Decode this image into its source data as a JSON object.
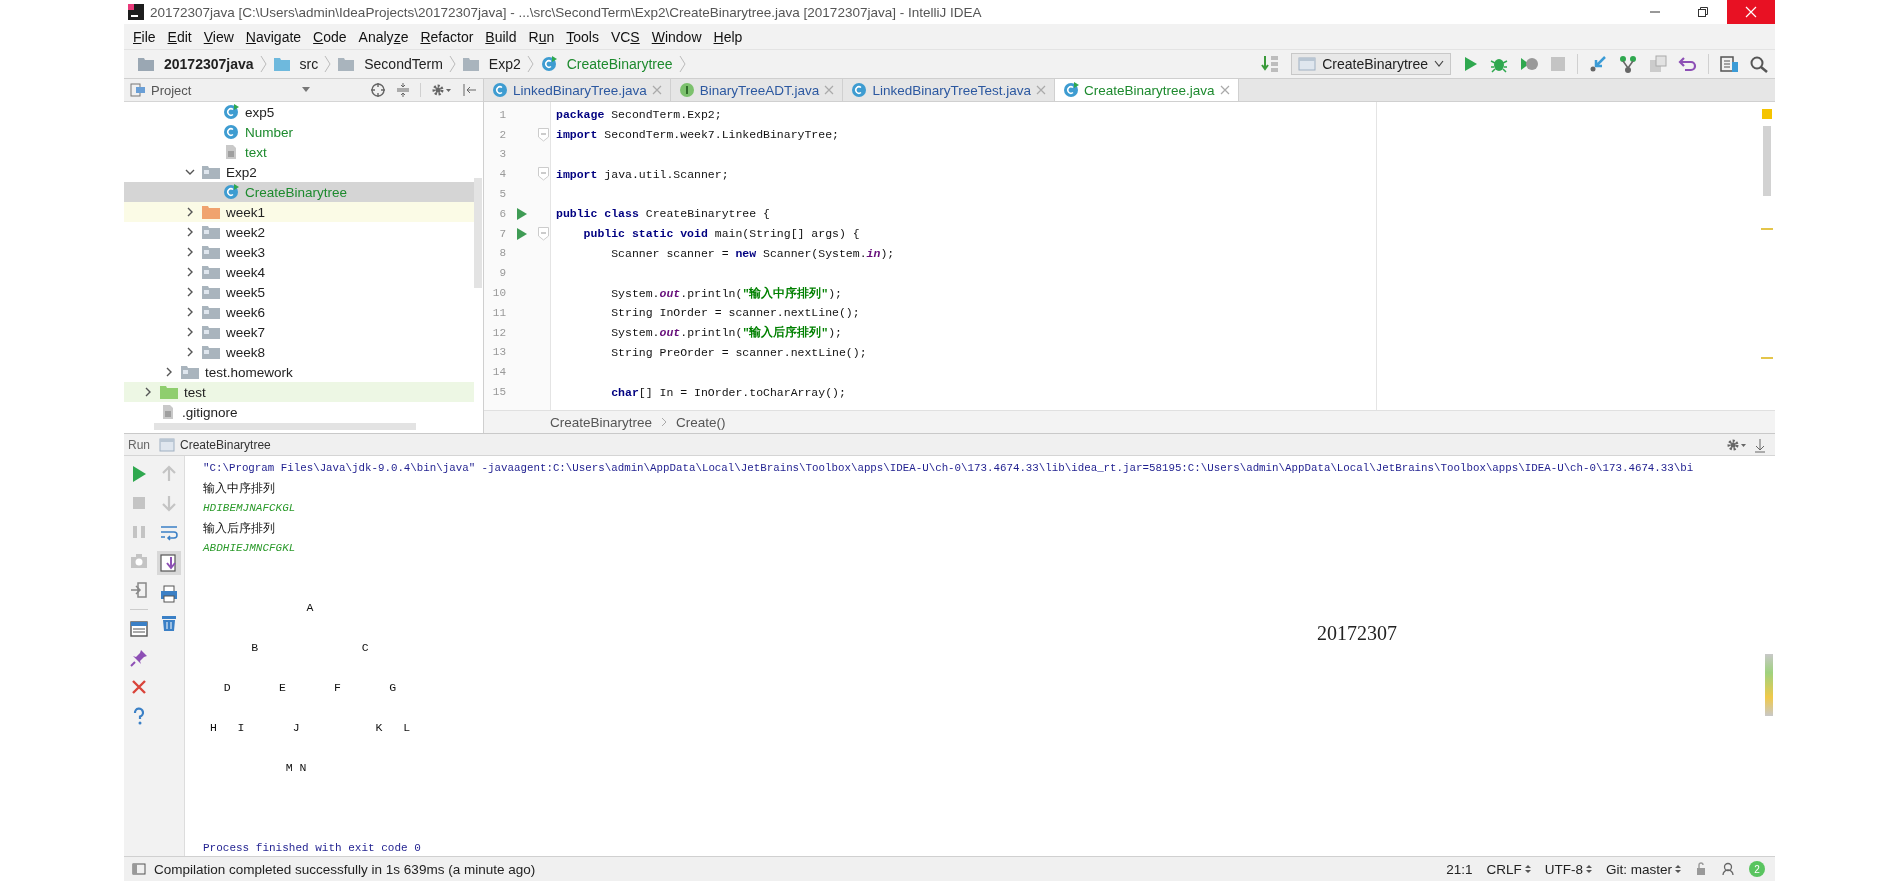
{
  "window": {
    "title": "20172307java [C:\\Users\\admin\\IdeaProjects\\20172307java] - ...\\src\\SecondTerm\\Exp2\\CreateBinarytree.java [20172307java] - IntelliJ IDEA"
  },
  "menu": [
    {
      "key": "F",
      "post": "ile"
    },
    {
      "key": "E",
      "post": "dit"
    },
    {
      "key": "V",
      "post": "iew"
    },
    {
      "key": "N",
      "post": "avigate"
    },
    {
      "key": "C",
      "post": "ode"
    },
    {
      "pre": "Analy",
      "key": "z",
      "post": "e"
    },
    {
      "key": "R",
      "post": "efactor"
    },
    {
      "key": "B",
      "post": "uild"
    },
    {
      "pre": "R",
      "key": "u",
      "post": "n"
    },
    {
      "key": "T",
      "post": "ools"
    },
    {
      "pre": "VC",
      "key": "S"
    },
    {
      "key": "W",
      "post": "indow"
    },
    {
      "key": "H",
      "post": "elp"
    }
  ],
  "breadcrumbs": [
    {
      "label": "20172307java",
      "kind": "project"
    },
    {
      "label": "src",
      "kind": "source_folder"
    },
    {
      "label": "SecondTerm",
      "kind": "folder"
    },
    {
      "label": "Exp2",
      "kind": "folder"
    },
    {
      "label": "CreateBinarytree",
      "kind": "main_class"
    }
  ],
  "run_configuration": "CreateBinarytree",
  "project": {
    "title": "Project",
    "tree": [
      {
        "children": [
          {
            "children": [
              {
                "children": [
                  {
                    "name": "exp5",
                    "kind": "main_class",
                    "vcs_added": false,
                    "selected": false
                  },
                  {
                    "name": "Number",
                    "kind": "class",
                    "vcs_added": true,
                    "selected": false
                  },
                  {
                    "name": "text",
                    "kind": "file",
                    "vcs_added": true,
                    "selected": false
                  }
                ]
              },
              {
                "name": "Exp2",
                "kind": "folder",
                "vcs_added": false,
                "expanded": true,
                "selected": false,
                "children": [
                  {
                    "name": "CreateBinarytree",
                    "kind": "main_class",
                    "vcs_added": true,
                    "selected": true
                  }
                ]
              },
              {
                "name": "week1",
                "kind": "resource_folder",
                "vcs_added": false,
                "expanded": false,
                "selected": false
              },
              {
                "name": "week2",
                "kind": "folder",
                "vcs_added": false,
                "expanded": false,
                "selected": false
              },
              {
                "name": "week3",
                "kind": "folder",
                "vcs_added": false,
                "expanded": false,
                "selected": false
              },
              {
                "name": "week4",
                "kind": "folder",
                "vcs_added": false,
                "expanded": false,
                "selected": false
              },
              {
                "name": "week5",
                "kind": "folder",
                "vcs_added": false,
                "expanded": false,
                "selected": false
              },
              {
                "name": "week6",
                "kind": "folder",
                "vcs_added": false,
                "expanded": false,
                "selected": false
              },
              {
                "name": "week7",
                "kind": "folder",
                "vcs_added": false,
                "expanded": false,
                "selected": false
              },
              {
                "name": "week8",
                "kind": "folder",
                "vcs_added": false,
                "expanded": false,
                "selected": false
              }
            ]
          },
          {
            "name": "test.homework",
            "kind": "folder",
            "vcs_added": false,
            "expanded": false,
            "selected": false
          }
        ]
      },
      {
        "name": "test",
        "kind": "test_folder",
        "vcs_added": false,
        "expanded": false,
        "selected": false
      },
      {
        "name": ".gitignore",
        "kind": "file",
        "vcs_added": false,
        "selected": false
      }
    ]
  },
  "tabs": [
    {
      "label": "LinkedBinaryTree.java",
      "kind": "class",
      "selected": false
    },
    {
      "label": "BinaryTreeADT.java",
      "kind": "interface",
      "selected": false
    },
    {
      "label": "LinkedBinaryTreeTest.java",
      "kind": "class",
      "selected": false
    },
    {
      "label": "CreateBinarytree.java",
      "kind": "main_class",
      "selected": true
    }
  ],
  "code": [
    {
      "number": "1",
      "run_marker": false,
      "fold": false,
      "tokens": [
        {
          "kind": "keyword",
          "text": "package"
        },
        {
          "kind": "plain",
          "text": " SecondTerm.Exp2;"
        }
      ]
    },
    {
      "number": "2",
      "run_marker": false,
      "fold": true,
      "tokens": [
        {
          "kind": "keyword",
          "text": "import"
        },
        {
          "kind": "plain",
          "text": " SecondTerm.week7.LinkedBinaryTree;"
        }
      ]
    },
    {
      "number": "3",
      "run_marker": false,
      "fold": false
    },
    {
      "number": "4",
      "run_marker": false,
      "fold": true,
      "tokens": [
        {
          "kind": "keyword",
          "text": "import"
        },
        {
          "kind": "plain",
          "text": " java.util.Scanner;"
        }
      ]
    },
    {
      "number": "5",
      "run_marker": false,
      "fold": false
    },
    {
      "number": "6",
      "run_marker": true,
      "fold": false,
      "tokens": [
        {
          "kind": "keyword",
          "text": "public class"
        },
        {
          "kind": "plain",
          "text": " CreateBinarytree {"
        }
      ]
    },
    {
      "number": "7",
      "run_marker": true,
      "fold": true,
      "tokens": [
        {
          "kind": "keyword",
          "text": "    public static void"
        },
        {
          "kind": "plain",
          "text": " main(String[] args) {"
        }
      ]
    },
    {
      "number": "8",
      "run_marker": false,
      "fold": false,
      "tokens": [
        {
          "kind": "plain",
          "text": "        Scanner scanner = "
        },
        {
          "kind": "keyword",
          "text": "new"
        },
        {
          "kind": "plain",
          "text": " Scanner(System."
        },
        {
          "kind": "field",
          "text": "in"
        },
        {
          "kind": "plain",
          "text": ");"
        }
      ]
    },
    {
      "number": "9",
      "run_marker": false,
      "fold": false
    },
    {
      "number": "10",
      "run_marker": false,
      "fold": false,
      "tokens": [
        {
          "kind": "plain",
          "text": "        System."
        },
        {
          "kind": "field",
          "text": "out"
        },
        {
          "kind": "plain",
          "text": ".println("
        },
        {
          "kind": "string",
          "text": "\"输入中序排列\""
        },
        {
          "kind": "plain",
          "text": ");"
        }
      ]
    },
    {
      "number": "11",
      "run_marker": false,
      "fold": false,
      "tokens": [
        {
          "kind": "plain",
          "text": "        String InOrder = scanner.nextLine();"
        }
      ]
    },
    {
      "number": "12",
      "run_marker": false,
      "fold": false,
      "tokens": [
        {
          "kind": "plain",
          "text": "        System."
        },
        {
          "kind": "field",
          "text": "out"
        },
        {
          "kind": "plain",
          "text": ".println("
        },
        {
          "kind": "string",
          "text": "\"输入后序排列\""
        },
        {
          "kind": "plain",
          "text": ");"
        }
      ]
    },
    {
      "number": "13",
      "run_marker": false,
      "fold": false,
      "tokens": [
        {
          "kind": "plain",
          "text": "        String PreOrder = scanner.nextLine();"
        }
      ]
    },
    {
      "number": "14",
      "run_marker": false,
      "fold": false
    },
    {
      "number": "15",
      "run_marker": false,
      "fold": false,
      "tokens": [
        {
          "kind": "keyword",
          "text": "        char"
        },
        {
          "kind": "plain",
          "text": "[] In = InOrder.toCharArray();"
        }
      ]
    }
  ],
  "editor_breadcrumbs": [
    "CreateBinarytree",
    "Create()"
  ],
  "run": {
    "label": "Run",
    "configuration": "CreateBinarytree",
    "output": [
      {
        "kind": "command",
        "text": "\"C:\\Program Files\\Java\\jdk-9.0.4\\bin\\java\" -javaagent:C:\\Users\\admin\\AppData\\Local\\JetBrains\\Toolbox\\apps\\IDEA-U\\ch-0\\173.4674.33\\lib\\idea_rt.jar=58195:C:\\Users\\admin\\AppData\\Local\\JetBrains\\Toolbox\\apps\\IDEA-U\\ch-0\\173.4674.33\\bi"
      },
      {
        "kind": "output",
        "text": "输入中序排列"
      },
      {
        "kind": "input",
        "text": "HDIBEMJNAFCKGL"
      },
      {
        "kind": "output",
        "text": "输入后序排列"
      },
      {
        "kind": "input",
        "text": "ABDHIEJMNCFGKL"
      }
    ],
    "tree_rows": [
      "               A",
      "       B               C",
      "   D       E       F       G",
      " H   I       J           K   L",
      "            M N"
    ],
    "exit_message": "Process finished with exit code 0",
    "overlay_text": "20172307"
  },
  "status_bar": {
    "message": "Compilation completed successfully in 1s 639ms (a minute ago)",
    "position": "21:1",
    "line_separator": "CRLF",
    "encoding": "UTF-8",
    "vcs": "Git: master",
    "notifications": "2"
  }
}
